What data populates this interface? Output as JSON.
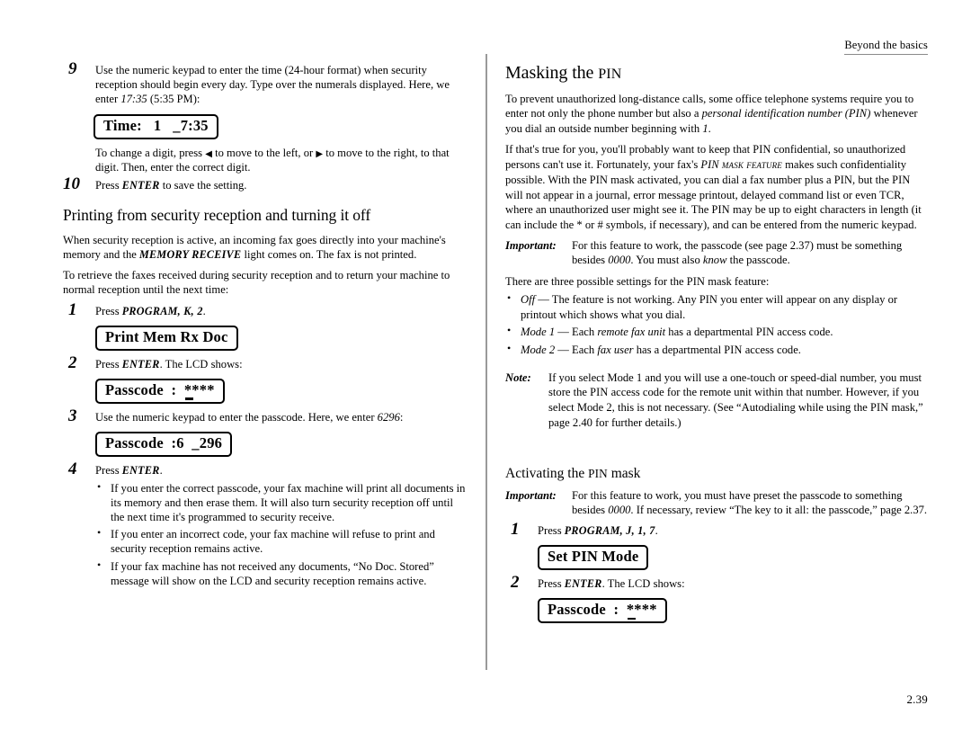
{
  "running_head": "Beyond the basics",
  "folio": "2.39",
  "left_column": {
    "step9": {
      "num": "9",
      "text_a": "Use the numeric keypad to enter the time (24-hour format) when security reception should begin every day. Type over the numerals displayed. Here, we enter ",
      "time_italic": "17:35",
      "text_b": " (5:35 ",
      "pm": "PM",
      "text_c": "):",
      "lcd": "Time:   1   _7:35",
      "after_a": "To change a digit, press ",
      "arrow_left": "◀",
      "after_b": " to move to the left, or ",
      "arrow_right": "▶",
      "after_c": " to move to the right, to that digit. Then, enter the correct digit."
    },
    "step10": {
      "num": "10",
      "text_a": "Press ",
      "key": "ENTER",
      "text_b": " to save the setting."
    },
    "subsection_title": "Printing from security reception and turning it off",
    "para1_a": "When security reception is active, an incoming fax goes directly into your machine's memory and the ",
    "para1_key": "MEMORY RECEIVE",
    "para1_b": " light comes on. The fax is not printed.",
    "para2": "To retrieve the faxes received during security reception and to return your machine to normal reception until the next time:",
    "step1": {
      "num": "1",
      "text_a": "Press ",
      "keys": "PROGRAM, K, 2",
      "text_b": ".",
      "lcd": "Print Mem Rx Doc"
    },
    "step2": {
      "num": "2",
      "text_a": "Press ",
      "key": "ENTER",
      "text_b": ". The ",
      "lcd_word": "LCD",
      "text_c": " shows:",
      "lcd_label": "Passcode  :  ",
      "lcd_value": "****"
    },
    "step3": {
      "num": "3",
      "text_a": "Use the numeric keypad to enter the passcode. Here, we enter ",
      "code_italic": "6296",
      "text_b": ":",
      "lcd": "Passcode  :6  _296"
    },
    "step4": {
      "num": "4",
      "text_a": "Press ",
      "key": "ENTER",
      "text_b": ".",
      "bullets": [
        "If you enter the correct passcode, your fax machine will print all documents in its memory and then erase them. It will also turn security reception off until the next time it's programmed to security receive.",
        "If you enter an incorrect code, your fax machine will refuse to print and security reception remains active.",
        "If your fax machine has not received any documents, “No Doc. Stored” message will show on the LCD and security reception remains active."
      ],
      "bullet3_a": "If your fax machine has not received any documents, “No Doc. Stored” message will show on the ",
      "bullet3_lcd": "LCD",
      "bullet3_b": " and security reception remains active."
    }
  },
  "right_column": {
    "title_a": "Masking the ",
    "title_pin": "PIN",
    "para1_a": "To prevent unauthorized long-distance calls, some office telephone systems require you to enter not only the phone number but also a ",
    "para1_ital": "personal identification number",
    "para1_b": " ",
    "para1_pin_ital": "(PIN)",
    "para1_c": " whenever you dial an outside number beginning with ",
    "para1_one": "1",
    "para1_d": ".",
    "para2_a": "If that's true for you, you'll probably want to keep that ",
    "para2_pin1": "PIN",
    "para2_b": " confidential, so unauthorized persons can't use it. Fortunately, your fax's ",
    "para2_feat": "PIN mask feature",
    "para2_c": " makes such confidentiality possible. With the ",
    "para2_pin2": "PIN",
    "para2_d": " mask activated, you can dial a fax number plus a ",
    "para2_pin3": "PIN",
    "para2_e": ", but the ",
    "para2_pin4": "PIN",
    "para2_f": " will not appear in a journal, error message printout, delayed command list or even ",
    "para2_tcr": "TCR",
    "para2_g": ", where an unauthorized user might see it. The ",
    "para2_pin5": "PIN",
    "para2_h": " may be up to eight characters in length (it can include the * or # symbols, if necessary), and can be entered from the numeric keypad.",
    "important1_label": "Important:",
    "important1_a": "For this feature to work, the passcode (see page 2.37) must be something besides ",
    "important1_zeros": "0000",
    "important1_b": ". You must also ",
    "important1_know": "know",
    "important1_c": " the passcode.",
    "settings_intro_a": "There are three possible settings for the ",
    "settings_intro_pin": "PIN",
    "settings_intro_b": " mask feature:",
    "settings": [
      {
        "term": "Off",
        "dash": " — ",
        "text_a": "The feature is not working. Any ",
        "pin": "PIN",
        "text_b": " you enter will appear on any display or printout which shows what you dial.",
        "mid_ital": ""
      },
      {
        "term": "Mode 1",
        "dash": " — ",
        "text_a": "Each ",
        "mid_ital": "remote fax unit",
        "text_mid": " has a departmental ",
        "pin": "PIN",
        "text_b": " access code."
      },
      {
        "term": "Mode 2",
        "dash": " — ",
        "text_a": "Each ",
        "mid_ital": "fax user",
        "text_mid": " has a departmental ",
        "pin": "PIN",
        "text_b": " access code."
      }
    ],
    "note_label": "Note:",
    "note_a": "If you select Mode 1 and you will use a one-touch or speed-dial number, you must store the ",
    "note_pin1": "PIN",
    "note_b": " access code for the remote unit within that number. However, if you select Mode 2, this is not necessary. (See “Autodialing while using the ",
    "note_pin2": "PIN",
    "note_c": " mask,” page 2.40 for further details.)",
    "sub_title_a": "Activating the ",
    "sub_title_pin": "PIN",
    "sub_title_b": " mask",
    "important2_label": "Important:",
    "important2_a": "For this feature to work, you must have preset the passcode to something besides ",
    "important2_zeros": "0000",
    "important2_b": ". If necessary, review “The key to it all: the passcode,” page 2.37.",
    "step1": {
      "num": "1",
      "text_a": "Press ",
      "keys": "PROGRAM, J, 1, 7",
      "text_b": ".",
      "lcd": "Set PIN Mode"
    },
    "step2": {
      "num": "2",
      "text_a": "Press ",
      "key": "ENTER",
      "text_b": ". The ",
      "lcd_word": "LCD",
      "text_c": " shows:",
      "lcd_label": "Passcode  :  ",
      "lcd_value": "****"
    }
  }
}
